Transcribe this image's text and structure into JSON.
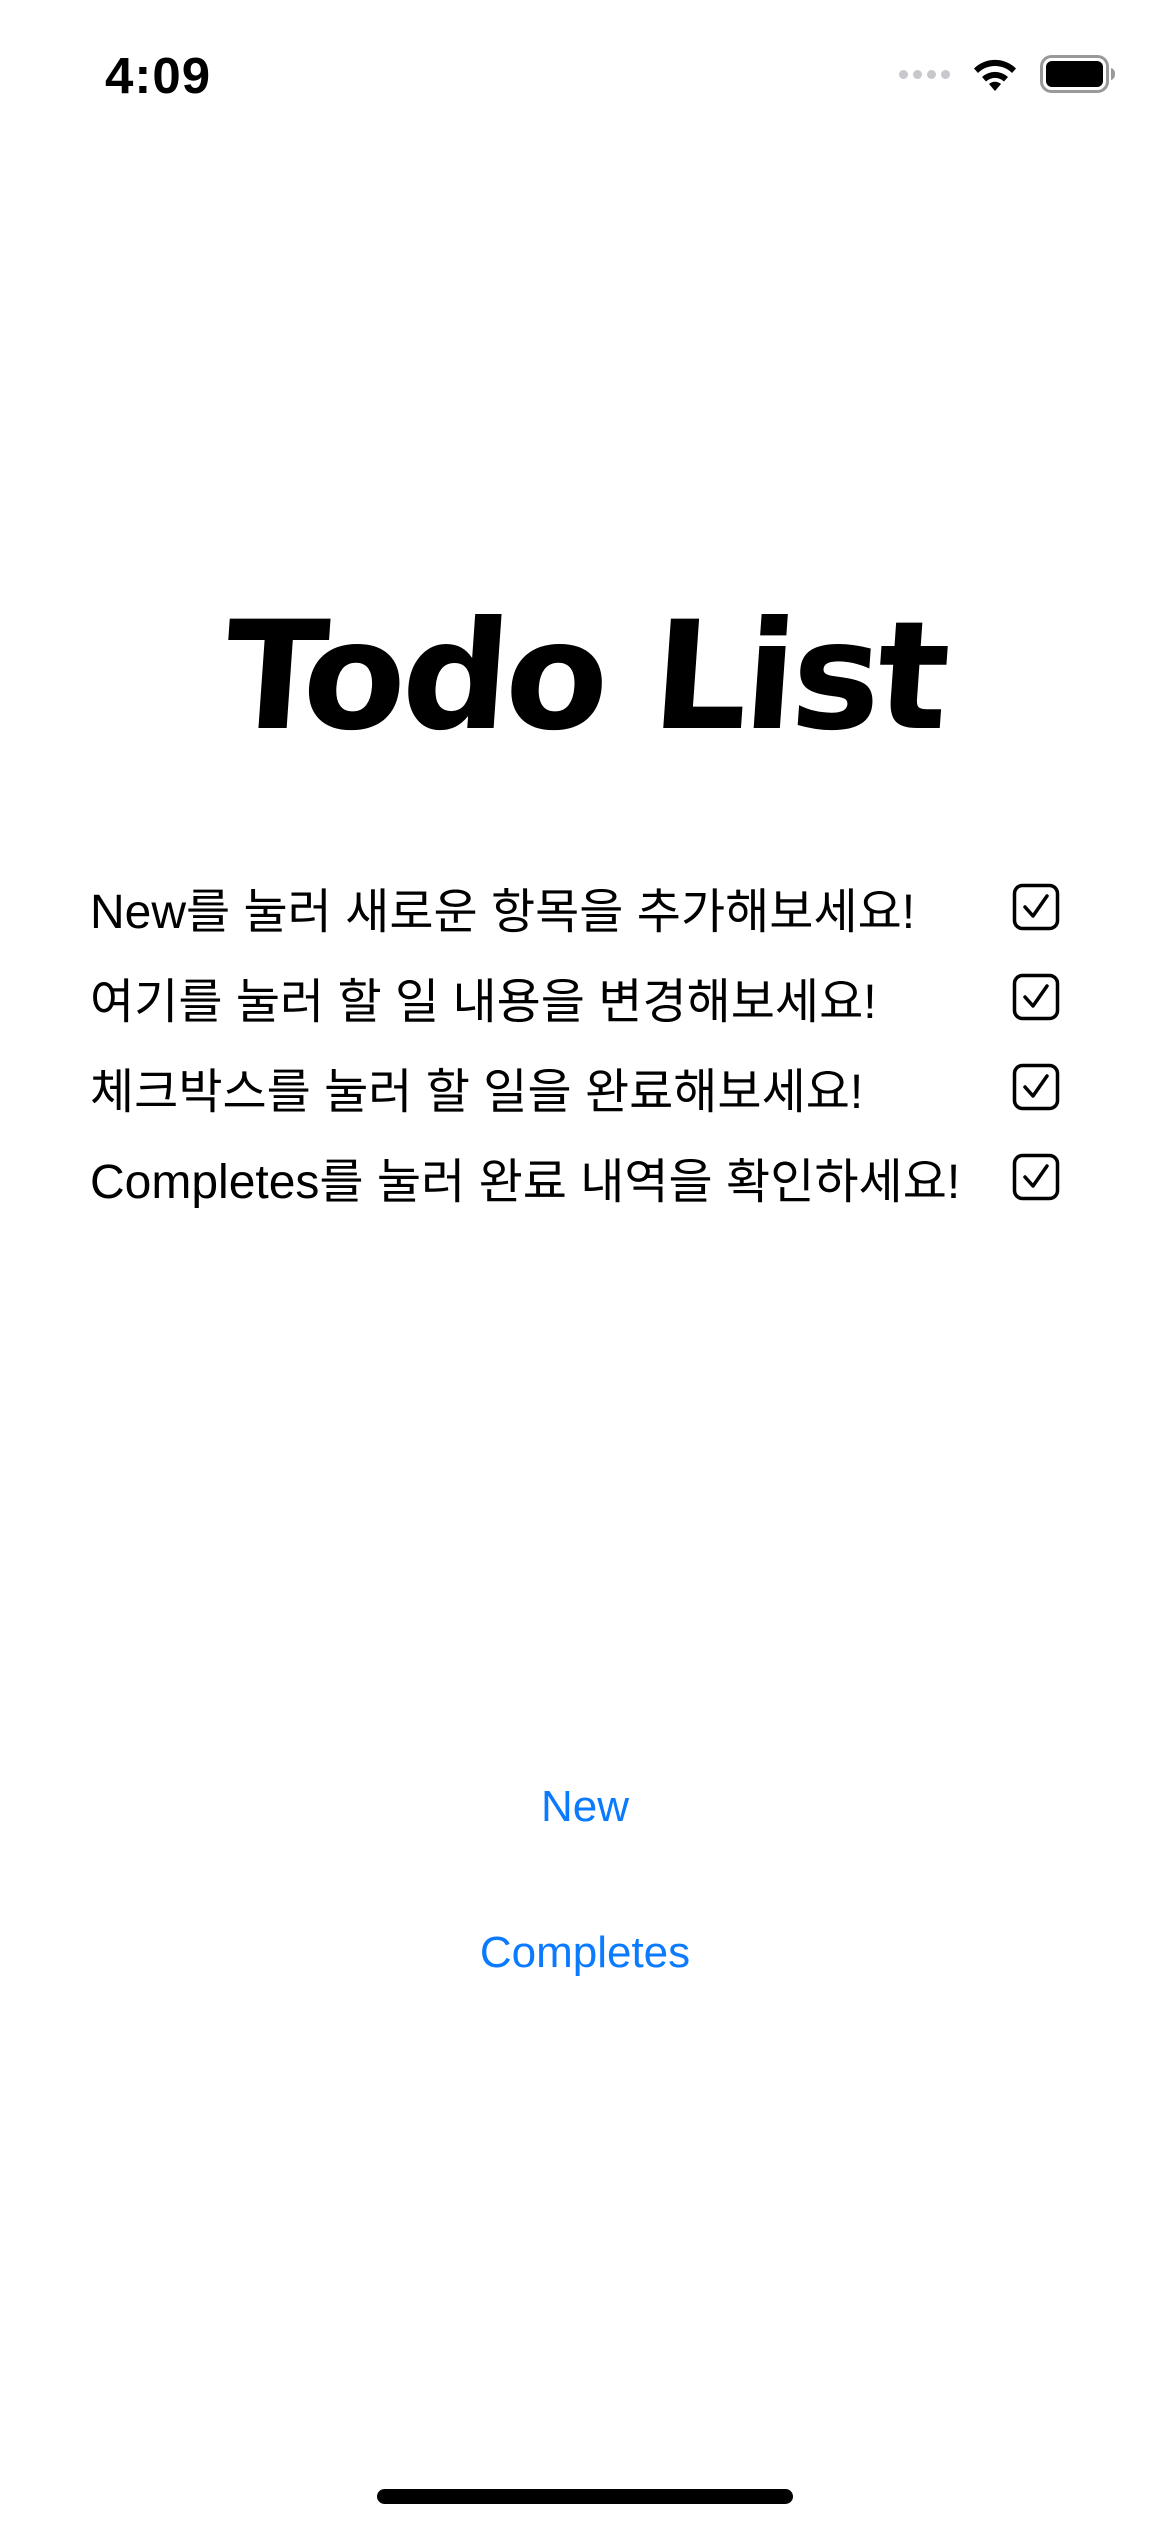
{
  "status_bar": {
    "time": "4:09",
    "icons": [
      "signal-icon",
      "wifi-icon",
      "battery-icon"
    ]
  },
  "title": "Todo List",
  "todos": [
    {
      "text": "New를 눌러 새로운 항목을 추가해보세요!",
      "checked": true
    },
    {
      "text": "여기를 눌러 할 일 내용을 변경해보세요!",
      "checked": true
    },
    {
      "text": "체크박스를 눌러 할 일을 완료해보세요!",
      "checked": true
    },
    {
      "text": "Completes를 눌러 완료 내역을 확인하세요!",
      "checked": true
    }
  ],
  "buttons": {
    "new_label": "New",
    "completes_label": "Completes"
  },
  "colors": {
    "accent": "#0a7aff",
    "text": "#000000",
    "background": "#ffffff"
  }
}
